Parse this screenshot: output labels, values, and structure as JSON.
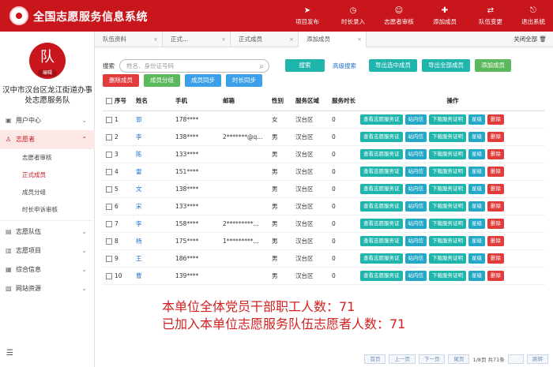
{
  "app": {
    "title": "全国志愿服务信息系统"
  },
  "topnav": [
    {
      "label": "项目发布",
      "icon": "send-icon"
    },
    {
      "label": "时长录入",
      "icon": "clock-icon"
    },
    {
      "label": "志愿者审核",
      "icon": "person-check-icon"
    },
    {
      "label": "添加成员",
      "icon": "add-user-icon"
    },
    {
      "label": "队伍变更",
      "icon": "team-change-icon"
    },
    {
      "label": "退出系统",
      "icon": "exit-icon"
    }
  ],
  "sidebar": {
    "avatar_char": "队",
    "avatar_edit": "编辑",
    "org_name_line1": "汉中市汉台区龙江街道办事",
    "org_name_line2": "处志愿服务队",
    "menu": [
      {
        "label": "用户中心",
        "icon": "user-icon"
      },
      {
        "label": "志愿者",
        "icon": "volunteer-icon",
        "children": [
          "志愿者审核",
          "正式成员",
          "成员分组",
          "时长申诉审核"
        ]
      },
      {
        "label": "志愿队伍",
        "icon": "team-icon"
      },
      {
        "label": "志愿项目",
        "icon": "project-icon"
      },
      {
        "label": "综合信息",
        "icon": "info-icon"
      },
      {
        "label": "网站资源",
        "icon": "web-icon"
      }
    ]
  },
  "tabs": [
    {
      "label": "队伍资料"
    },
    {
      "label": "正式..."
    },
    {
      "label": "正式成员"
    },
    {
      "label": "添加成员"
    }
  ],
  "close_all": "关闭全部",
  "search": {
    "label": "搜索",
    "placeholder": "姓名、身份证号码",
    "button": "搜索",
    "advanced": "高级搜索"
  },
  "actions": {
    "export_selected": "导出选中成员",
    "export_all": "导出全部成员",
    "add_member": "添加成员",
    "delete_member": "删除成员",
    "member_group": "成员分组",
    "member_sync": "成员同步",
    "hours_sync": "时长同步"
  },
  "table": {
    "headers": [
      "序号",
      "姓名",
      "手机",
      "邮箱",
      "性别",
      "服务区域",
      "服务时长",
      "操作"
    ],
    "op_labels": [
      "查看志愿服务证",
      "站内信",
      "下载服务证明",
      "星级",
      "删除"
    ],
    "rows": [
      {
        "no": "1",
        "name": "郭",
        "phone": "178****",
        "email": "",
        "gender": "女",
        "area": "汉台区",
        "hours": "0"
      },
      {
        "no": "2",
        "name": "李",
        "phone": "138****",
        "email": "2*******@q...",
        "gender": "男",
        "area": "汉台区",
        "hours": "0"
      },
      {
        "no": "3",
        "name": "陈",
        "phone": "133****",
        "email": "",
        "gender": "男",
        "area": "汉台区",
        "hours": "0"
      },
      {
        "no": "4",
        "name": "雷",
        "phone": "151****",
        "email": "",
        "gender": "男",
        "area": "汉台区",
        "hours": "0"
      },
      {
        "no": "5",
        "name": "文",
        "phone": "138****",
        "email": "",
        "gender": "男",
        "area": "汉台区",
        "hours": "0"
      },
      {
        "no": "6",
        "name": "宋",
        "phone": "133****",
        "email": "",
        "gender": "男",
        "area": "汉台区",
        "hours": "0"
      },
      {
        "no": "7",
        "name": "李",
        "phone": "158****",
        "email": "2*********...",
        "gender": "男",
        "area": "汉台区",
        "hours": "0"
      },
      {
        "no": "8",
        "name": "杨",
        "phone": "175****",
        "email": "1*********...",
        "gender": "男",
        "area": "汉台区",
        "hours": "0"
      },
      {
        "no": "9",
        "name": "王",
        "phone": "186****",
        "email": "",
        "gender": "男",
        "area": "汉台区",
        "hours": "0"
      },
      {
        "no": "10",
        "name": "曹",
        "phone": "139****",
        "email": "",
        "gender": "男",
        "area": "汉台区",
        "hours": "0"
      }
    ]
  },
  "overlay": {
    "line1": "本单位全体党员干部职工人数：71",
    "line2": "已加入本单位志愿服务队伍志愿者人数：71"
  },
  "pager": {
    "first": "首页",
    "prev": "上一页",
    "next": "下一页",
    "last": "尾页",
    "info": "1/8页 共71条",
    "jump": "跳转"
  },
  "colors": {
    "brand": "#c9161c",
    "teal": "#1fb5ac",
    "green": "#5cb85c",
    "blue": "#3ba0e9",
    "danger": "#e13c3c"
  }
}
